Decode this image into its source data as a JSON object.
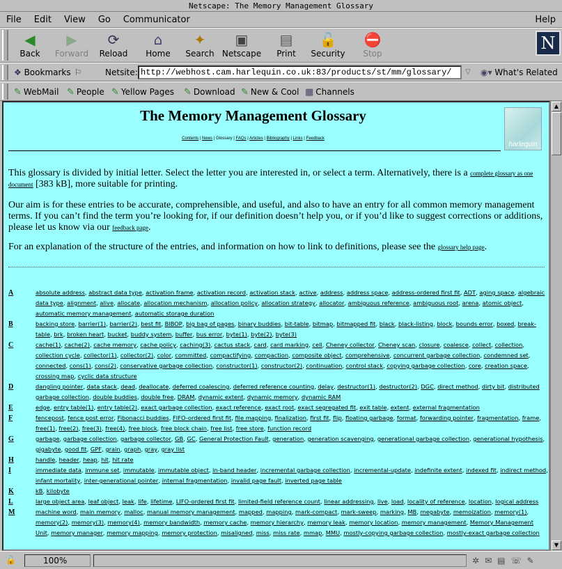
{
  "window": {
    "title": "Netscape: The Memory Management Glossary"
  },
  "menu": [
    "File",
    "Edit",
    "View",
    "Go",
    "Communicator"
  ],
  "menu_help": "Help",
  "toolbar": [
    {
      "label": "Back",
      "icon": "back-arrow-icon",
      "glyph": "◀",
      "color": "#2a8a2a",
      "enabled": true
    },
    {
      "label": "Forward",
      "icon": "forward-arrow-icon",
      "glyph": "▶",
      "color": "#88aa88",
      "enabled": false
    },
    {
      "label": "Reload",
      "icon": "reload-icon",
      "glyph": "⟳",
      "color": "#335",
      "enabled": true
    },
    {
      "label": "Home",
      "icon": "home-icon",
      "glyph": "⌂",
      "color": "#446",
      "enabled": true
    },
    {
      "label": "Search",
      "icon": "search-icon",
      "glyph": "✦",
      "color": "#aa7700",
      "enabled": true
    },
    {
      "label": "Netscape",
      "icon": "netscape-icon",
      "glyph": "▣",
      "color": "#444",
      "enabled": true
    },
    {
      "label": "Print",
      "icon": "print-icon",
      "glyph": "▤",
      "color": "#555",
      "enabled": true
    },
    {
      "label": "Security",
      "icon": "lock-icon",
      "glyph": "🔓",
      "color": "#a33",
      "enabled": true
    },
    {
      "label": "Stop",
      "icon": "stop-icon",
      "glyph": "⛔",
      "color": "#a88",
      "enabled": false
    }
  ],
  "logo_letter": "N",
  "location": {
    "bookmarks_label": "Bookmarks",
    "field_label": "Netsite:",
    "url": "http://webhost.cam.harlequin.co.uk:83/products/st/mm/glossary/",
    "related_label": "What's Related"
  },
  "personal": [
    "WebMail",
    "People",
    "Yellow Pages",
    "Download",
    "New & Cool",
    "Channels"
  ],
  "page": {
    "title": "The Memory Management Glossary",
    "nav": [
      "Contents",
      "News",
      "Glossary",
      "FAQs",
      "Articles",
      "Bibliography",
      "Links",
      "Feedback"
    ],
    "logo_text": "harlequin",
    "p1_before": "This glossary is divided by initial letter. Select the letter you are interested in, or select a term. Alternatively, there is a ",
    "p1_link": "complete glossary as one document",
    "p1_after": " [383 kB], more suitable for printing.",
    "p2_before": "Our aim is for these entries to be accurate, comprehensible, and useful, and also to have an entry for all common memory management terms. If you can’t find the term you’re looking for, if our definition doesn’t help you, or if you’d like to suggest corrections or additions, please let us know via our ",
    "p2_link": "feedback page",
    "p2_after": ".",
    "p3_before": "For an explanation of the structure of the entries, and information on how to link to definitions, please see the ",
    "p3_link": "glossary help page",
    "p3_after": "."
  },
  "letters": [
    {
      "letter": "A",
      "terms": [
        "absolute address",
        "abstract data type",
        "activation frame",
        "activation record",
        "activation stack",
        "active",
        "address",
        "address space",
        "address-ordered first fit",
        "ADT",
        "aging space",
        "algebraic data type",
        "alignment",
        "alive",
        "allocate",
        "allocation mechanism",
        "allocation policy",
        "allocation strategy",
        "allocator",
        "ambiguous reference",
        "ambiguous root",
        "arena",
        "atomic object",
        "automatic memory management",
        "automatic storage duration"
      ]
    },
    {
      "letter": "B",
      "terms": [
        "backing store",
        "barrier(1)",
        "barrier(2)",
        "best fit",
        "BIBOP",
        "big bag of pages",
        "binary buddies",
        "bit-table",
        "bitmap",
        "bitmapped fit",
        "black",
        "black-listing",
        "block",
        "bounds error",
        "boxed",
        "break-table",
        "brk",
        "broken heart",
        "bucket",
        "buddy system",
        "buffer",
        "bus error",
        "byte(1)",
        "byte(2)",
        "byte(3)"
      ]
    },
    {
      "letter": "C",
      "terms": [
        "cache(1)",
        "cache(2)",
        "cache memory",
        "cache policy",
        "caching(3)",
        "cactus stack",
        "card",
        "card marking",
        "cell",
        "Cheney collector",
        "Cheney scan",
        "closure",
        "coalesce",
        "collect",
        "collection",
        "collection cycle",
        "collector(1)",
        "collector(2)",
        "color",
        "committed",
        "compactifying",
        "compaction",
        "composite object",
        "comprehensive",
        "concurrent garbage collection",
        "condemned set",
        "connected",
        "cons(1)",
        "cons(2)",
        "conservative garbage collection",
        "constructor(1)",
        "constructor(2)",
        "continuation",
        "control stack",
        "copying garbage collection",
        "core",
        "creation space",
        "crossing map",
        "cyclic data structure"
      ]
    },
    {
      "letter": "D",
      "terms": [
        "dangling pointer",
        "data stack",
        "dead",
        "deallocate",
        "deferred coalescing",
        "deferred reference counting",
        "delay",
        "destructor(1)",
        "destructor(2)",
        "DGC",
        "direct method",
        "dirty bit",
        "distributed garbage collection",
        "double buddies",
        "double free",
        "DRAM",
        "dynamic extent",
        "dynamic memory",
        "dynamic RAM"
      ]
    },
    {
      "letter": "E",
      "terms": [
        "edge",
        "entry table(1)",
        "entry table(2)",
        "exact garbage collection",
        "exact reference",
        "exact root",
        "exact segregated fit",
        "exit table",
        "extent",
        "external fragmentation"
      ]
    },
    {
      "letter": "F",
      "terms": [
        "fencepost",
        "fence post error",
        "Fibonacci buddies",
        "FIFO-ordered first fit",
        "file mapping",
        "finalization",
        "first fit",
        "flip",
        "floating garbage",
        "format",
        "forwarding pointer",
        "fragmentation",
        "frame",
        "free(1)",
        "free(2)",
        "free(3)",
        "free(4)",
        "free block",
        "free block chain",
        "free list",
        "free store",
        "function record"
      ]
    },
    {
      "letter": "G",
      "terms": [
        "garbage",
        "garbage collection",
        "garbage collector",
        "GB",
        "GC",
        "General Protection Fault",
        "generation",
        "generation scavenging",
        "generational garbage collection",
        "generational hypothesis",
        "gigabyte",
        "good fit",
        "GPF",
        "grain",
        "graph",
        "gray",
        "gray list"
      ]
    },
    {
      "letter": "H",
      "terms": [
        "handle",
        "header",
        "heap",
        "hit",
        "hit rate"
      ]
    },
    {
      "letter": "I",
      "terms": [
        "immediate data",
        "immune set",
        "immutable",
        "immutable object",
        "in-band header",
        "incremental garbage collection",
        "incremental-update",
        "indefinite extent",
        "indexed fit",
        "indirect method",
        "infant mortality",
        "inter-generational pointer",
        "internal fragmentation",
        "invalid page fault",
        "inverted page table"
      ]
    },
    {
      "letter": "K",
      "terms": [
        "kB",
        "kilobyte"
      ]
    },
    {
      "letter": "L",
      "terms": [
        "large object area",
        "leaf object",
        "leak",
        "life",
        "lifetime",
        "LIFO-ordered first fit",
        "limited-field reference count",
        "linear addressing",
        "live",
        "load",
        "locality of reference",
        "location",
        "logical address"
      ]
    },
    {
      "letter": "M",
      "terms": [
        "machine word",
        "main memory",
        "malloc",
        "manual memory management",
        "mapped",
        "mapping",
        "mark-compact",
        "mark-sweep",
        "marking",
        "MB",
        "megabyte",
        "memoization",
        "memory(1)",
        "memory(2)",
        "memory(3)",
        "memory(4)",
        "memory bandwidth",
        "memory cache",
        "memory hierarchy",
        "memory leak",
        "memory location",
        "memory management",
        "Memory Management Unit",
        "memory manager",
        "memory mapping",
        "memory protection",
        "misaligned",
        "miss",
        "miss rate",
        "mmap",
        "MMU",
        "mostly-copying garbage collection",
        "mostly-exact garbage collection"
      ]
    }
  ],
  "status": {
    "zoom": "100%"
  }
}
